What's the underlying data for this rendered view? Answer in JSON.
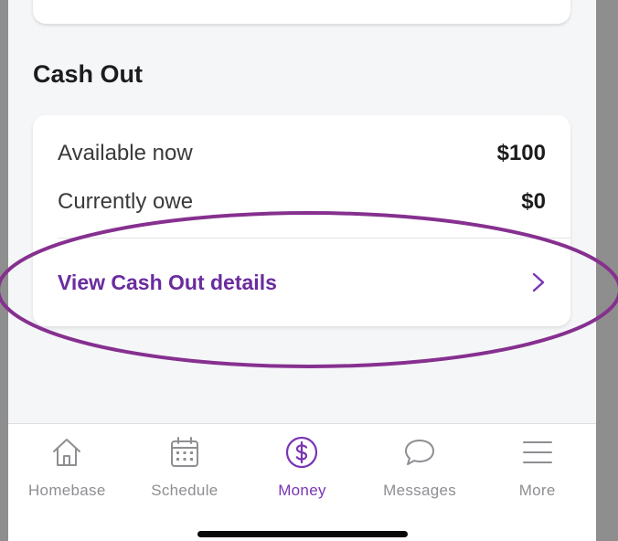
{
  "colors": {
    "accent": "#6a2c9e",
    "tab_active": "#7a35b5",
    "tab_inactive": "#8e8e93",
    "annotation": "#86308f"
  },
  "section": {
    "title": "Cash Out"
  },
  "cash_out_card": {
    "rows": [
      {
        "label": "Available now",
        "value": "$100"
      },
      {
        "label": "Currently owe",
        "value": "$0"
      }
    ],
    "link": {
      "label": "View Cash Out details",
      "icon": "chevron-right-icon"
    }
  },
  "tabbar": {
    "active": "Money",
    "tabs": [
      {
        "label": "Homebase",
        "icon": "home-icon"
      },
      {
        "label": "Schedule",
        "icon": "calendar-icon"
      },
      {
        "label": "Money",
        "icon": "dollar-circle-icon"
      },
      {
        "label": "Messages",
        "icon": "chat-bubble-icon"
      },
      {
        "label": "More",
        "icon": "menu-icon"
      }
    ]
  }
}
